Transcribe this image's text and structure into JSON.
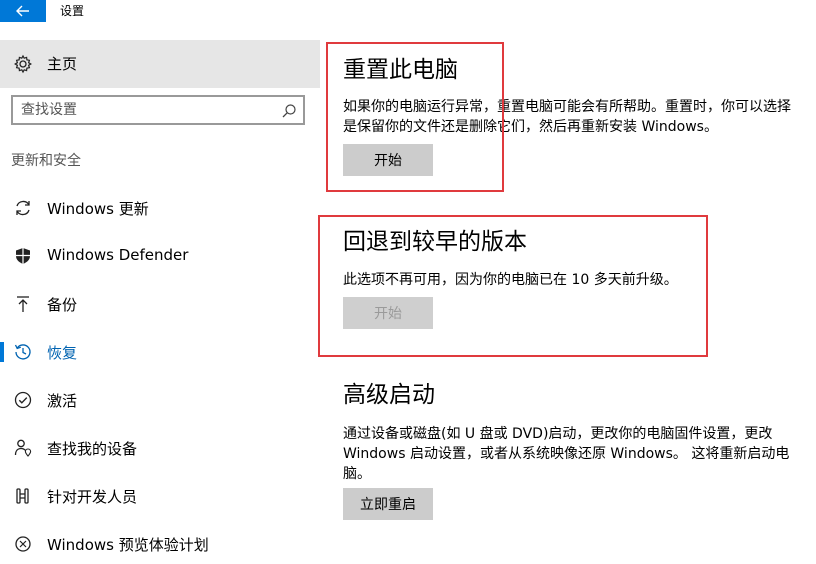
{
  "app": {
    "title": "设置"
  },
  "sidebar": {
    "home_label": "主页",
    "search_placeholder": "查找设置",
    "section_label": "更新和安全",
    "items": [
      {
        "label": "Windows 更新",
        "icon": "sync-icon"
      },
      {
        "label": "Windows Defender",
        "icon": "shield-icon"
      },
      {
        "label": "备份",
        "icon": "upload-arrow-icon"
      },
      {
        "label": "恢复",
        "icon": "history-icon",
        "active": true
      },
      {
        "label": "激活",
        "icon": "check-circle-icon"
      },
      {
        "label": "查找我的设备",
        "icon": "person-location-icon"
      },
      {
        "label": "针对开发人员",
        "icon": "developer-tools-icon"
      },
      {
        "label": "Windows 预览体验计划",
        "icon": "insider-icon"
      }
    ]
  },
  "main": {
    "reset": {
      "title": "重置此电脑",
      "description": "如果你的电脑运行异常，重置电脑可能会有所帮助。重置时，你可以选择是保留你的文件还是删除它们，然后再重新安装 Windows。",
      "button": "开始"
    },
    "goback": {
      "title": "回退到较早的版本",
      "description": "此选项不再可用，因为你的电脑已在 10 多天前升级。",
      "button": "开始",
      "button_disabled": true
    },
    "advanced": {
      "title": "高级启动",
      "description": "通过设备或磁盘(如 U 盘或 DVD)启动，更改你的电脑固件设置，更改 Windows 启动设置，或者从系统映像还原 Windows。 这将重新启动电脑。",
      "button": "立即重启"
    }
  },
  "colors": {
    "accent": "#0078d7",
    "highlight_box": "#e03a3e",
    "button_bg": "#cccccc"
  }
}
